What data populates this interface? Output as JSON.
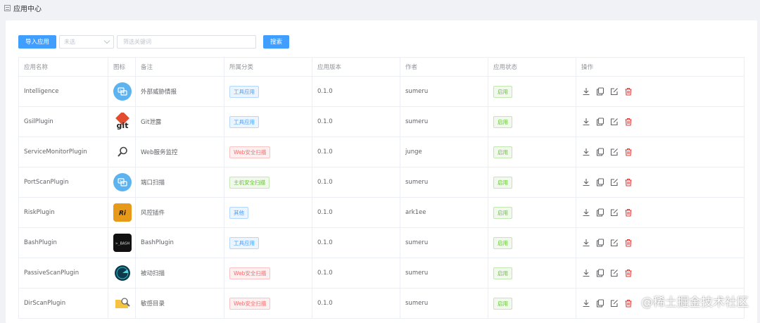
{
  "page": {
    "title": "应用中心"
  },
  "toolbar": {
    "import_label": "导入应用",
    "filter_value": "未选",
    "search_placeholder": "筛选关键词",
    "search_label": "搜索"
  },
  "table": {
    "headers": [
      "应用名称",
      "图标",
      "备注",
      "所属分类",
      "应用版本",
      "作者",
      "应用状态",
      "操作"
    ],
    "rows": [
      {
        "name": "Intelligence",
        "icon": "tools-icon",
        "note": "外部威胁情报",
        "category": "工具应用",
        "category_color": "blue",
        "version": "0.1.0",
        "author": "sumeru",
        "status": "启用"
      },
      {
        "name": "GsilPlugin",
        "icon": "git-logo",
        "note": "Git泄露",
        "category": "工具应用",
        "category_color": "blue",
        "version": "0.1.0",
        "author": "sumeru",
        "status": "启用"
      },
      {
        "name": "ServiceMonitorPlugin",
        "icon": "magnifier-icon",
        "note": "Web服务监控",
        "category": "Web安全扫描",
        "category_color": "red",
        "version": "0.1.0",
        "author": "junge",
        "status": "启用"
      },
      {
        "name": "PortScanPlugin",
        "icon": "tools-icon",
        "note": "端口扫描",
        "category": "主机安全扫描",
        "category_color": "green",
        "version": "0.1.0",
        "author": "sumeru",
        "status": "启用"
      },
      {
        "name": "RiskPlugin",
        "icon": "risk-icon",
        "note": "风控插件",
        "category": "其他",
        "category_color": "blue",
        "version": "0.1.0",
        "author": "ark1ee",
        "status": "启用"
      },
      {
        "name": "BashPlugin",
        "icon": "bash-icon",
        "note": "BashPlugin",
        "category": "工具应用",
        "category_color": "blue",
        "version": "0.1.0",
        "author": "sumeru",
        "status": "启用"
      },
      {
        "name": "PassiveScanPlugin",
        "icon": "radar-icon",
        "note": "被动扫描",
        "category": "Web安全扫描",
        "category_color": "red",
        "version": "0.1.0",
        "author": "sumeru",
        "status": "启用"
      },
      {
        "name": "DirScanPlugin",
        "icon": "folder-search-icon",
        "note": "敏感目录",
        "category": "Web安全扫描",
        "category_color": "red",
        "version": "0.1.0",
        "author": "sumeru",
        "status": "启用"
      }
    ],
    "operations": [
      "download-icon",
      "copy-icon",
      "edit-icon",
      "delete-icon"
    ]
  },
  "colors": {
    "primary": "#409eff",
    "danger": "#f56c6c",
    "success": "#67c23a"
  },
  "watermark": "@稀土掘金技术社区"
}
